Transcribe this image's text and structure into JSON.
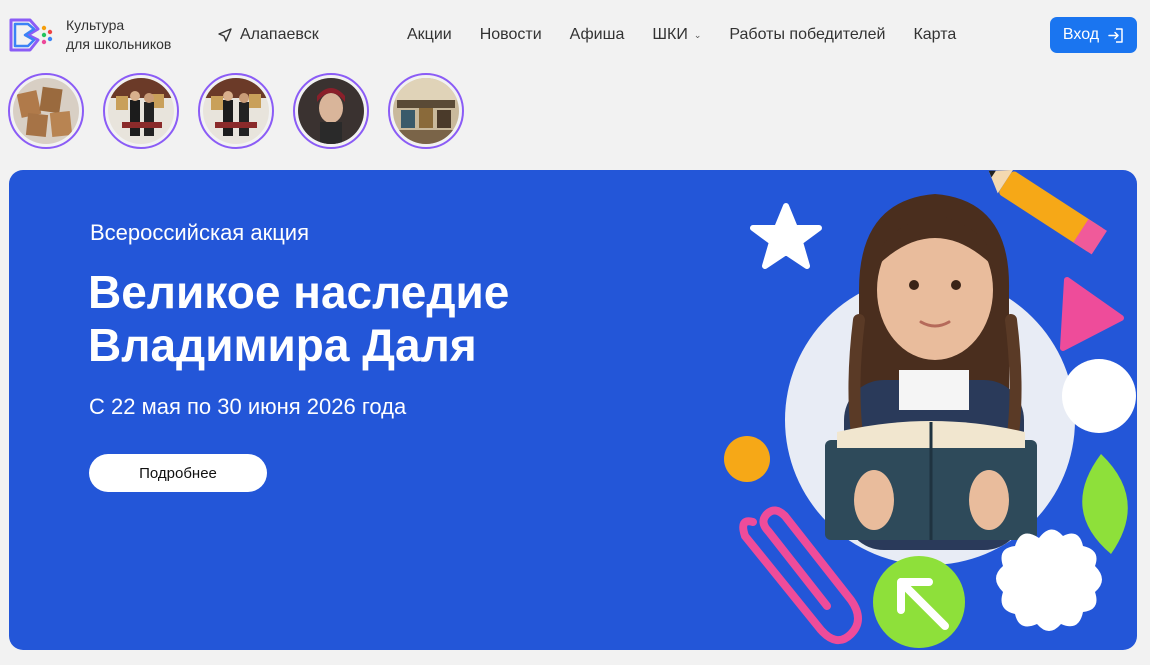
{
  "header": {
    "logo_text": [
      "Культура",
      "для школьников"
    ],
    "city": "Алапаевск",
    "nav": [
      {
        "label": "Акции",
        "dropdown": false
      },
      {
        "label": "Новости",
        "dropdown": false
      },
      {
        "label": "Афиша",
        "dropdown": false
      },
      {
        "label": "ШКИ",
        "dropdown": true
      },
      {
        "label": "Работы победителей",
        "dropdown": false
      },
      {
        "label": "Карта",
        "dropdown": false
      }
    ],
    "login_label": "Вход"
  },
  "stories": [
    {
      "icon": "story-thumbnail"
    },
    {
      "icon": "story-thumbnail"
    },
    {
      "icon": "story-thumbnail"
    },
    {
      "icon": "story-thumbnail"
    },
    {
      "icon": "story-thumbnail"
    }
  ],
  "banner": {
    "eyebrow": "Всероссийская акция",
    "title_line1": "Великое наследие",
    "title_line2": "Владимира Даля",
    "dates": "С 22 мая по 30 июня 2026 года",
    "button_label": "Подробнее"
  },
  "colors": {
    "accent": "#1a75f0",
    "banner_bg": "#2356d8",
    "story_ring": "#8b5cf6",
    "page_bg": "#f2f2f2"
  }
}
